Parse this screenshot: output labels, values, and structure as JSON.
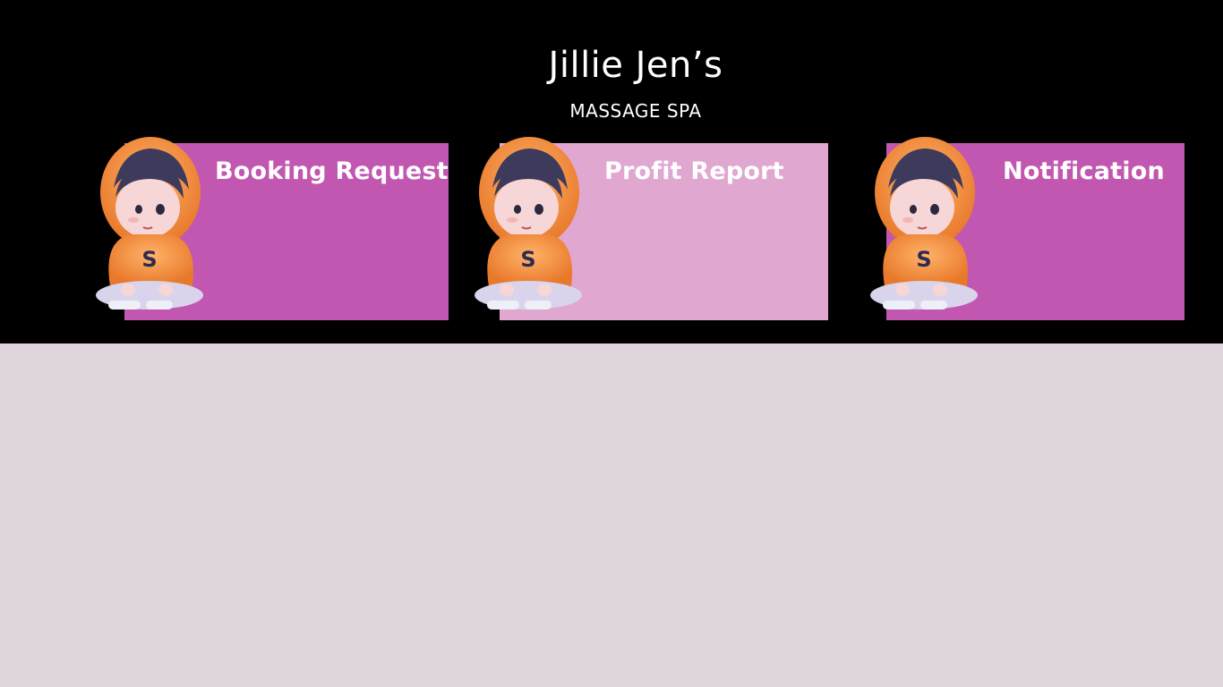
{
  "brand": {
    "title": "Jillie Jen’s",
    "subtitle": "MASSAGE SPA"
  },
  "cards": [
    {
      "label": "Booking Request",
      "color": "#c157b0",
      "icon": "mascot-icon"
    },
    {
      "label": "Profit Report",
      "color": "#e0a7d1",
      "icon": "mascot-icon"
    },
    {
      "label": "Notification",
      "color": "#c157b0",
      "icon": "mascot-icon"
    }
  ],
  "colors": {
    "header_bg": "#000000",
    "page_bg": "#e0d6dd",
    "hoodie": "#f79a3e",
    "hair": "#3d3a5c",
    "letter": "S"
  }
}
